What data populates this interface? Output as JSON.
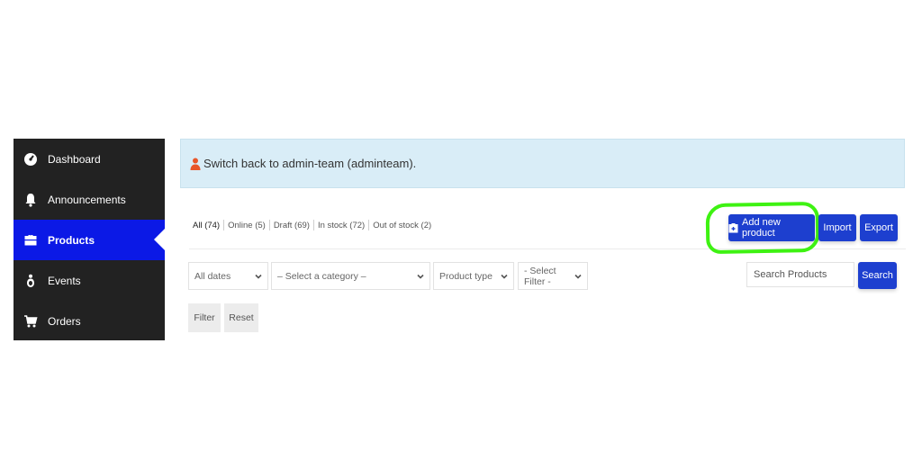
{
  "sidebar": {
    "items": [
      {
        "label": "Dashboard",
        "icon": "dashboard-icon"
      },
      {
        "label": "Announcements",
        "icon": "bell-icon"
      },
      {
        "label": "Products",
        "icon": "briefcase-icon"
      },
      {
        "label": "Events",
        "icon": "person-icon"
      },
      {
        "label": "Orders",
        "icon": "cart-icon"
      }
    ],
    "active_item": "Products"
  },
  "notice": {
    "text": "Switch back to admin-team (adminteam).",
    "icon": "user-icon"
  },
  "status_tabs": [
    {
      "label": "All (74)"
    },
    {
      "label": "Online (5)"
    },
    {
      "label": "Draft (69)"
    },
    {
      "label": "In stock (72)"
    },
    {
      "label": "Out of stock (2)"
    }
  ],
  "actions": {
    "add_new_product": "Add new product",
    "import": "Import",
    "export": "Export"
  },
  "filters": {
    "dates": "All dates",
    "category": "– Select a category –",
    "product_type": "Product type",
    "select_filter": "- Select Filter -",
    "filter_button": "Filter",
    "reset_button": "Reset"
  },
  "search": {
    "placeholder": "Search Products",
    "button": "Search"
  },
  "colors": {
    "sidebar_bg": "#222222",
    "active_nav": "#0b19e6",
    "button_blue": "#1d3fcf",
    "notice_bg": "#d9edf7",
    "highlight": "#3ef212"
  }
}
